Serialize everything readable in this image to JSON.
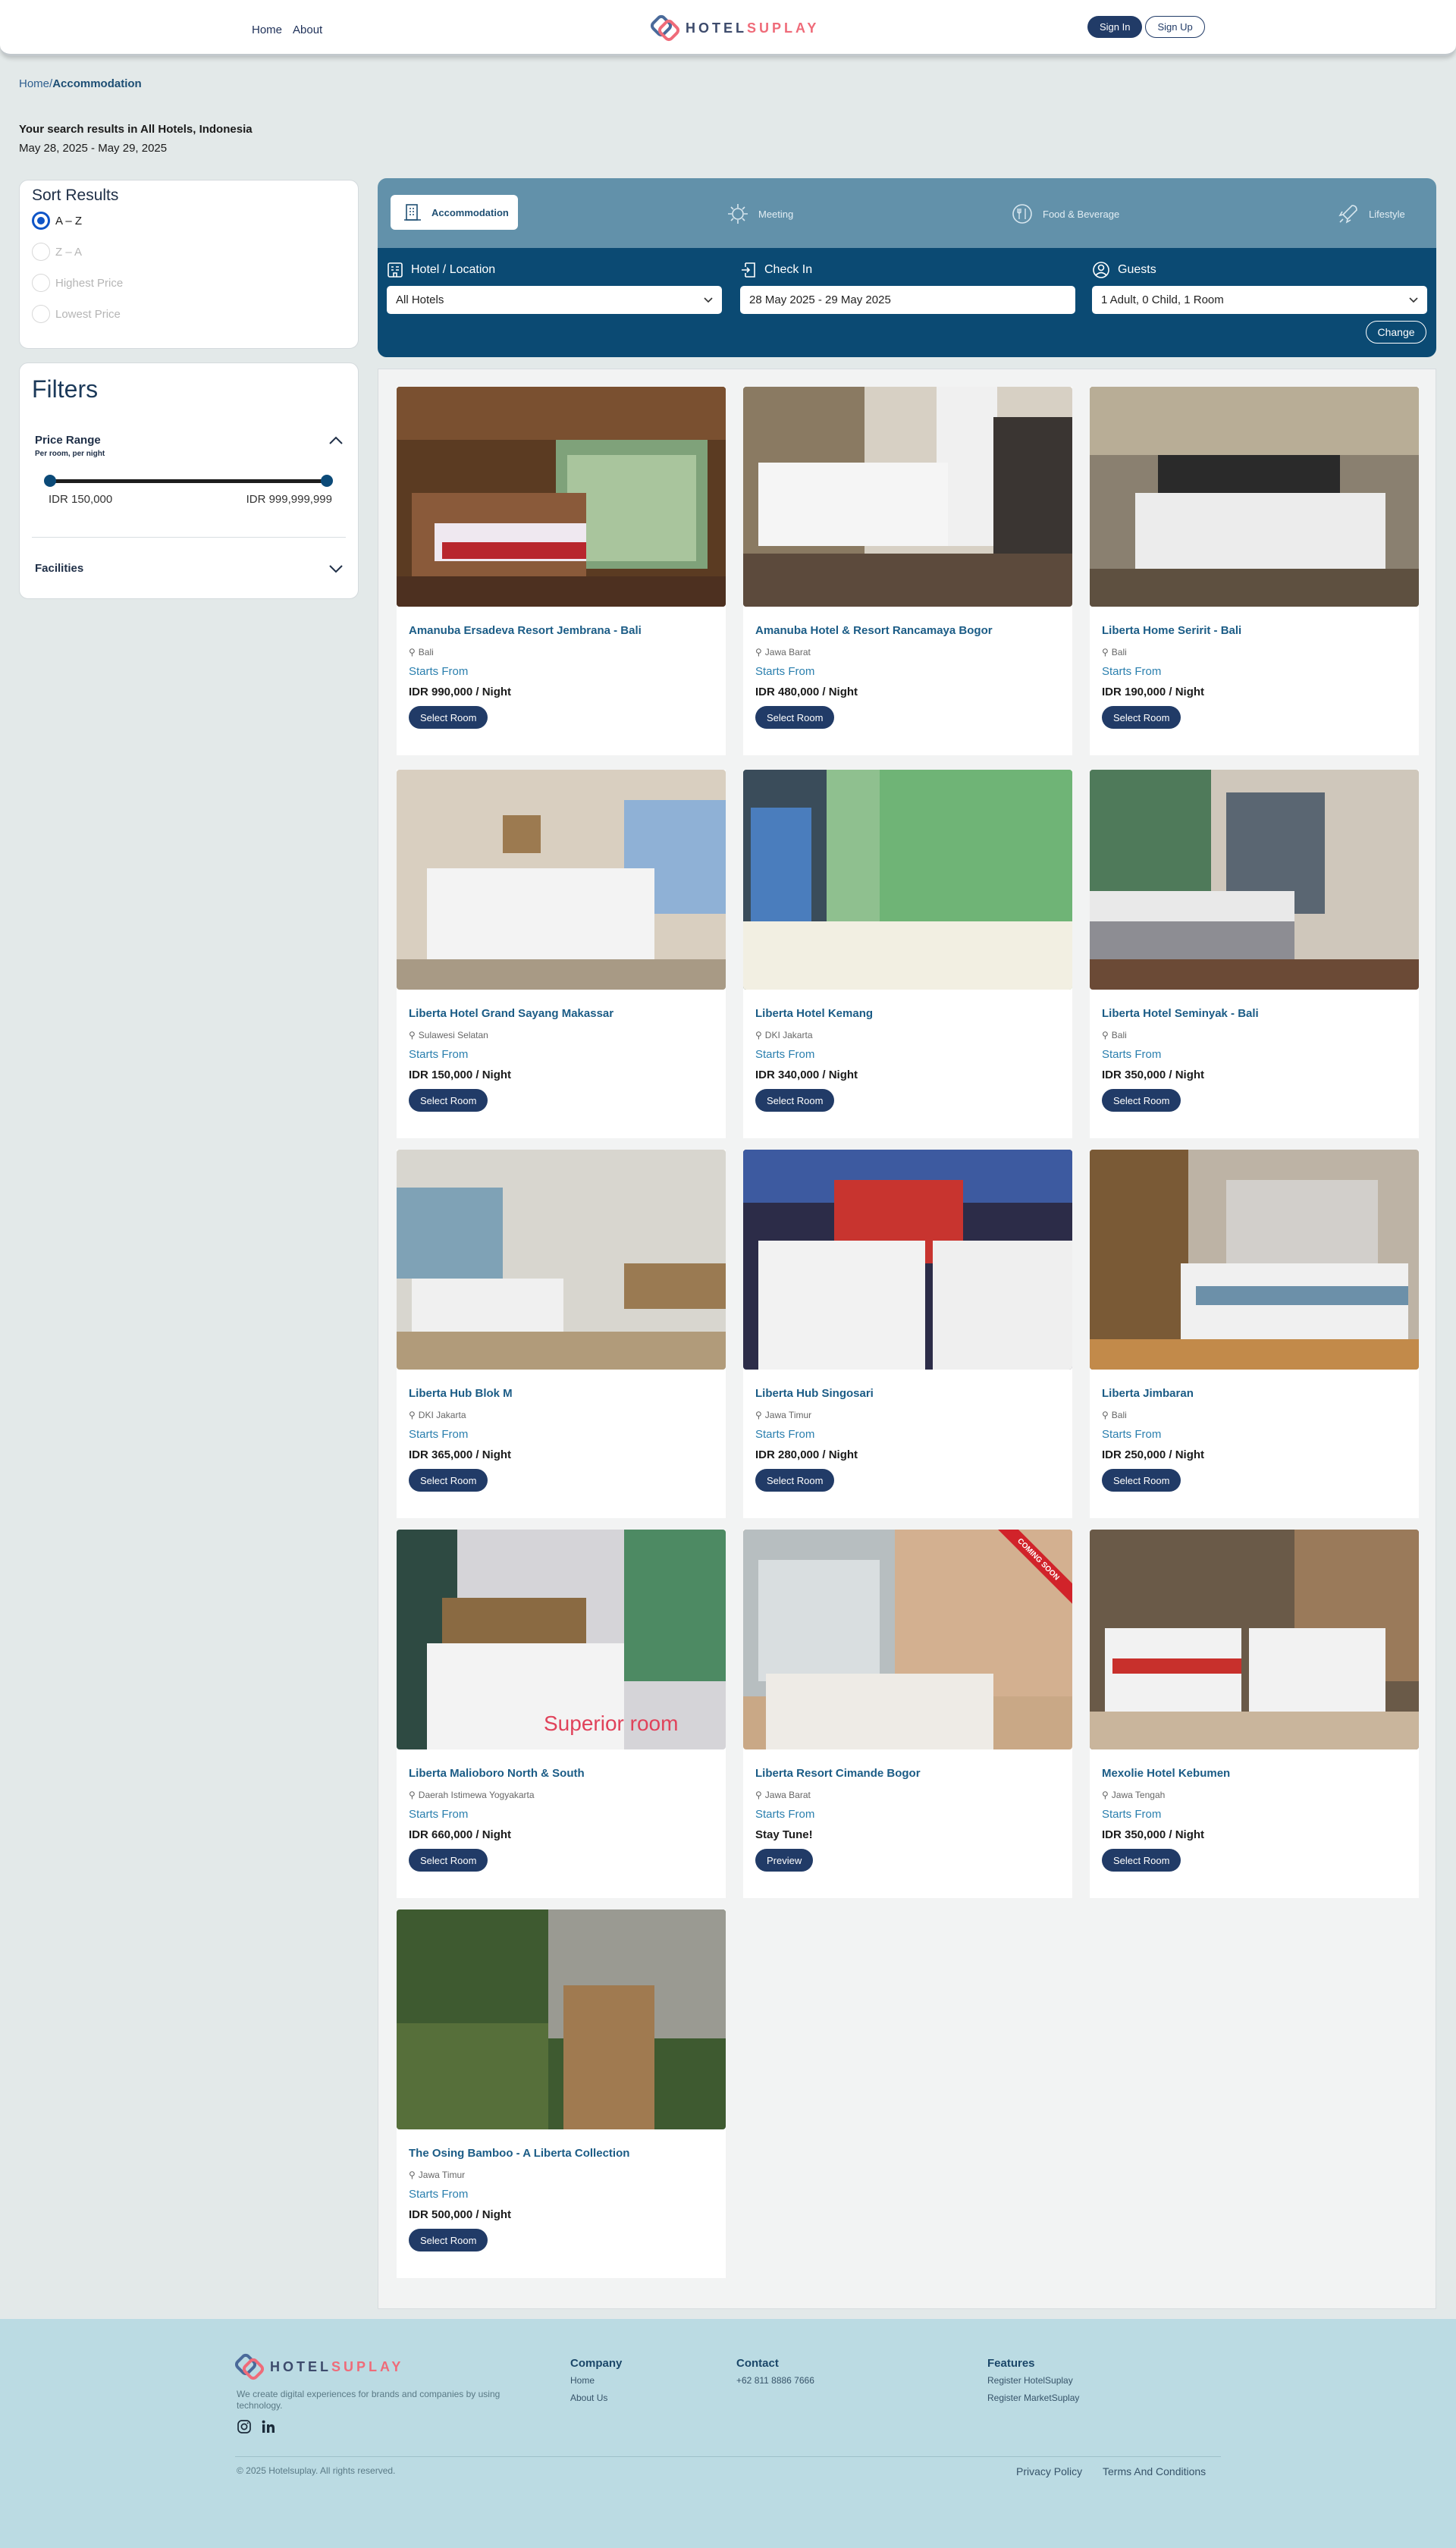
{
  "header": {
    "nav": [
      "Home",
      "About"
    ],
    "brand_left": "HOTEL",
    "brand_right": "SUPLAY",
    "sign_in": "Sign In",
    "sign_up": "Sign Up"
  },
  "breadcrumb": {
    "home": "Home",
    "sep": "/",
    "current": "Accommodation"
  },
  "search": {
    "title": "Your search results in All Hotels, Indonesia",
    "dates": "May 28, 2025 - May 29, 2025"
  },
  "sort": {
    "title": "Sort Results",
    "options": [
      "A – Z",
      "Z – A",
      "Highest Price",
      "Lowest Price"
    ],
    "selected": "A – Z"
  },
  "filters": {
    "title": "Filters",
    "price_range": "Price Range",
    "price_sub": "Per room, per night",
    "min": "IDR 150,000",
    "max": "IDR 999,999,999",
    "facilities": "Facilities"
  },
  "tabs": [
    "Accommodation",
    "Meeting",
    "Food & Beverage",
    "Lifestyle"
  ],
  "booking": {
    "location_label": "Hotel / Location",
    "location_value": "All Hotels",
    "checkin_label": "Check In",
    "checkin_value": "28 May 2025 - 29 May 2025",
    "guests_label": "Guests",
    "guests_value": "1 Adult, 0 Child, 1 Room",
    "change": "Change"
  },
  "hotels": [
    {
      "name": "Amanuba Ersadeva Resort Jembrana - Bali",
      "location": "Bali",
      "starts": "Starts From",
      "price": "IDR 990,000 / Night",
      "button": "Select Room"
    },
    {
      "name": "Amanuba Hotel & Resort Rancamaya Bogor",
      "location": "Jawa Barat",
      "starts": "Starts From",
      "price": "IDR 480,000 / Night",
      "button": "Select Room"
    },
    {
      "name": "Liberta Home Seririt - Bali",
      "location": "Bali",
      "starts": "Starts From",
      "price": "IDR 190,000 / Night",
      "button": "Select Room"
    },
    {
      "name": "Liberta Hotel Grand Sayang Makassar",
      "location": "Sulawesi Selatan",
      "starts": "Starts From",
      "price": "IDR 150,000 / Night",
      "button": "Select Room"
    },
    {
      "name": "Liberta Hotel Kemang",
      "location": "DKI Jakarta",
      "starts": "Starts From",
      "price": "IDR 340,000 / Night",
      "button": "Select Room"
    },
    {
      "name": "Liberta Hotel Seminyak - Bali",
      "location": "Bali",
      "starts": "Starts From",
      "price": "IDR 350,000 / Night",
      "button": "Select Room"
    },
    {
      "name": "Liberta Hub Blok M",
      "location": "DKI Jakarta",
      "starts": "Starts From",
      "price": "IDR 365,000 / Night",
      "button": "Select Room"
    },
    {
      "name": "Liberta Hub Singosari",
      "location": "Jawa Timur",
      "starts": "Starts From",
      "price": "IDR 280,000 / Night",
      "button": "Select Room"
    },
    {
      "name": "Liberta Jimbaran",
      "location": "Bali",
      "starts": "Starts From",
      "price": "IDR 250,000 / Night",
      "button": "Select Room"
    },
    {
      "name": "Liberta Malioboro North & South",
      "location": "Daerah Istimewa Yogyakarta",
      "starts": "Starts From",
      "price": "IDR 660,000 / Night",
      "button": "Select Room",
      "overlay": "Superior room"
    },
    {
      "name": "Liberta Resort Cimande Bogor",
      "location": "Jawa Barat",
      "starts": "Starts From",
      "price": "Stay Tune!",
      "button": "Preview",
      "ribbon": "COMING SOON"
    },
    {
      "name": "Mexolie Hotel Kebumen",
      "location": "Jawa Tengah",
      "starts": "Starts From",
      "price": "IDR 350,000 / Night",
      "button": "Select Room"
    },
    {
      "name": "The Osing Bamboo - A Liberta Collection",
      "location": "Jawa Timur",
      "starts": "Starts From",
      "price": "IDR 500,000 / Night",
      "button": "Select Room"
    }
  ],
  "footer": {
    "tagline": "We create digital experiences for brands and companies by using technology.",
    "company_title": "Company",
    "company_links": [
      "Home",
      "About Us"
    ],
    "contact_title": "Contact",
    "phone": "+62 811 8886 7666",
    "features_title": "Features",
    "features_links": [
      "Register HotelSuplay",
      "Register MarketSuplay"
    ],
    "copyright": "© 2025 Hotelsuplay. All rights reserved.",
    "privacy": "Privacy Policy",
    "terms": "Terms And Conditions"
  }
}
